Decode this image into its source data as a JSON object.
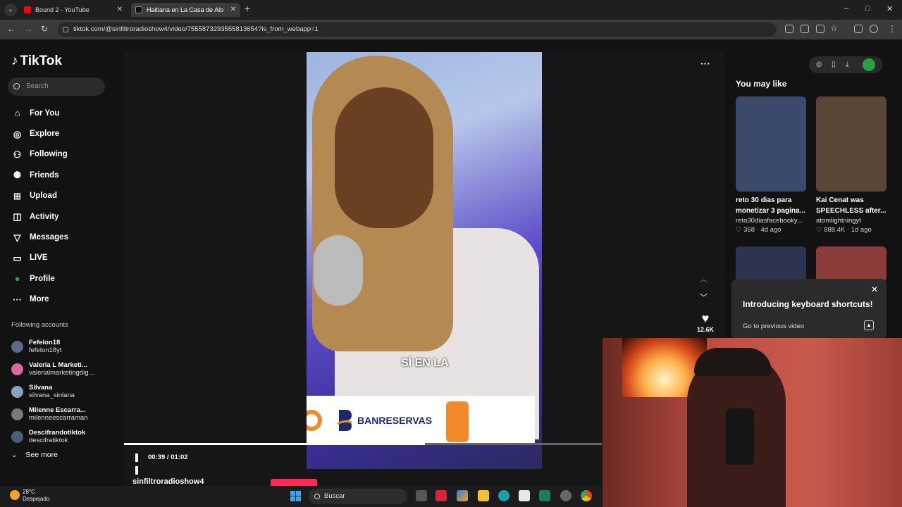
{
  "browser": {
    "tabs": [
      {
        "label": "Bound 2 - YouTube",
        "active": false
      },
      {
        "label": "Haitiana en La Casa de Alo",
        "active": true
      }
    ],
    "url": "tiktok.com/@sinfiltroradioshow4/video/7555873293555813654?is_from_webapp=1",
    "window_controls": [
      "–",
      "□",
      "✕"
    ]
  },
  "sidebar": {
    "logo": "TikTok",
    "search_placeholder": "Search",
    "nav": [
      {
        "icon": "home-icon",
        "glyph": "⌂",
        "label": "For You"
      },
      {
        "icon": "compass-icon",
        "glyph": "◎",
        "label": "Explore"
      },
      {
        "icon": "following-icon",
        "glyph": "⚇",
        "label": "Following"
      },
      {
        "icon": "friends-icon",
        "glyph": "⚉",
        "label": "Friends"
      },
      {
        "icon": "upload-icon",
        "glyph": "⊞",
        "label": "Upload"
      },
      {
        "icon": "activity-icon",
        "glyph": "◫",
        "label": "Activity"
      },
      {
        "icon": "messages-icon",
        "glyph": "▽",
        "label": "Messages"
      },
      {
        "icon": "live-icon",
        "glyph": "▭",
        "label": "LIVE"
      },
      {
        "icon": "profile-icon",
        "glyph": "●",
        "label": "Profile"
      },
      {
        "icon": "more-icon",
        "glyph": "···",
        "label": "More"
      }
    ],
    "accounts_title": "Following accounts",
    "accounts": [
      {
        "name": "Fefelon18",
        "handle": "fefelon18yt",
        "color": "#5a6b8c"
      },
      {
        "name": "Valeria L Marketi...",
        "handle": "valerialmarketingdig...",
        "color": "#d96aa0"
      },
      {
        "name": "Silvana",
        "handle": "silvana_sinlana",
        "color": "#8aa3c2"
      },
      {
        "name": "Milenne Escarra...",
        "handle": "milenneescarraman",
        "color": "#7a7a7a"
      },
      {
        "name": "Descifrandotiktok",
        "handle": "descifratiktok",
        "color": "#4a5d7a"
      }
    ],
    "see_more": "See more"
  },
  "player": {
    "caption": "SÍ EN LA",
    "ad_brand": "BANRESERVAS",
    "time": "00:39 / 01:02",
    "progress": 0.63,
    "likes": "12.6K",
    "username": "sinfiltroradioshow4"
  },
  "recommendations": {
    "title": "You may like",
    "items": [
      {
        "title": "reto 30 dias para monetizar 3 pagina...",
        "author": "reto30diasfacebooky...",
        "meta": "♡ 368 · 4d ago",
        "color": "#3b4a6b"
      },
      {
        "title": "Kai Cenat was SPEECHLESS after...",
        "author": "atomlightningyt",
        "meta": "♡ 888.4K · 1d ago",
        "color": "#5a4636"
      },
      {
        "title": "",
        "author": "",
        "meta": "",
        "color": "#2c3550"
      },
      {
        "title": "",
        "author": "",
        "meta": "",
        "color": "#8c3b3b"
      }
    ]
  },
  "popup": {
    "title": "Introducing keyboard shortcuts!",
    "link": "Go to previous video"
  },
  "taskbar": {
    "temp": "28°C",
    "condition": "Despejado",
    "search": "Buscar"
  }
}
